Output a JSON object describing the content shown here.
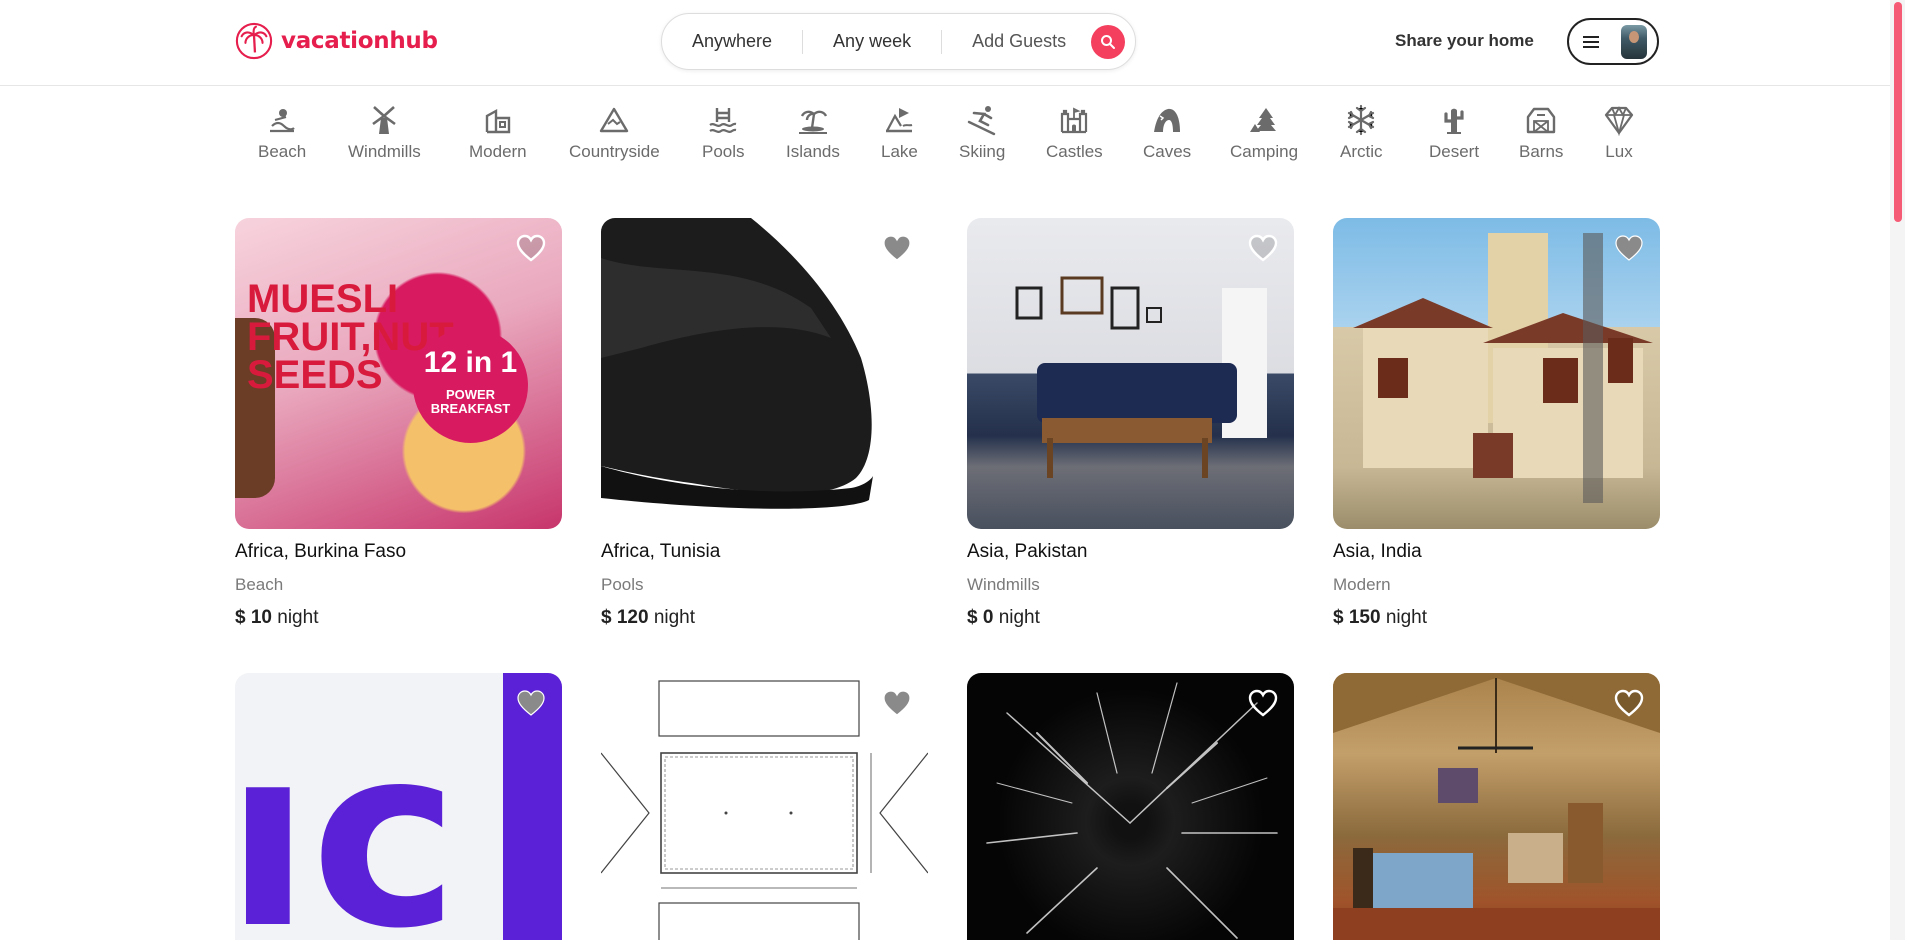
{
  "brand": {
    "name": "vacationhub",
    "color": "#e61e4d"
  },
  "search": {
    "where": "Anywhere",
    "when": "Any week",
    "guests": "Add Guests",
    "button_color": "#f43f5e"
  },
  "header": {
    "share_label": "Share your home"
  },
  "categories": [
    {
      "label": "Beach",
      "icon": "beach-icon"
    },
    {
      "label": "Windmills",
      "icon": "windmill-icon"
    },
    {
      "label": "Modern",
      "icon": "modern-icon"
    },
    {
      "label": "Countryside",
      "icon": "mountain-icon"
    },
    {
      "label": "Pools",
      "icon": "pool-icon"
    },
    {
      "label": "Islands",
      "icon": "island-icon"
    },
    {
      "label": "Lake",
      "icon": "lake-icon"
    },
    {
      "label": "Skiing",
      "icon": "ski-icon"
    },
    {
      "label": "Castles",
      "icon": "castle-icon"
    },
    {
      "label": "Caves",
      "icon": "cave-icon"
    },
    {
      "label": "Camping",
      "icon": "camping-icon"
    },
    {
      "label": "Arctic",
      "icon": "snowflake-icon"
    },
    {
      "label": "Desert",
      "icon": "cactus-icon"
    },
    {
      "label": "Barns",
      "icon": "barn-icon"
    },
    {
      "label": "Lux",
      "icon": "diamond-icon"
    }
  ],
  "listings": [
    {
      "location": "Africa, Burkina Faso",
      "category": "Beach",
      "price": "$ 10",
      "unit": "night",
      "heart": "outline"
    },
    {
      "location": "Africa, Tunisia",
      "category": "Pools",
      "price": "$ 120",
      "unit": "night",
      "heart": "filled"
    },
    {
      "location": "Asia, Pakistan",
      "category": "Windmills",
      "price": "$ 0",
      "unit": "night",
      "heart": "outline"
    },
    {
      "location": "Asia, India",
      "category": "Modern",
      "price": "$ 150",
      "unit": "night",
      "heart": "filled"
    },
    {
      "heart": "filled"
    },
    {
      "heart": "filled"
    },
    {
      "heart": "outline"
    },
    {
      "heart": "outline"
    }
  ],
  "image_text": {
    "muesli": "MUESLI\nFRUIT,NUT\nSEEDS",
    "muesli_badge": "12 in 1",
    "muesli_badge_sub": "POWER\nBREAKFAST",
    "logo_letters": "ıc"
  }
}
